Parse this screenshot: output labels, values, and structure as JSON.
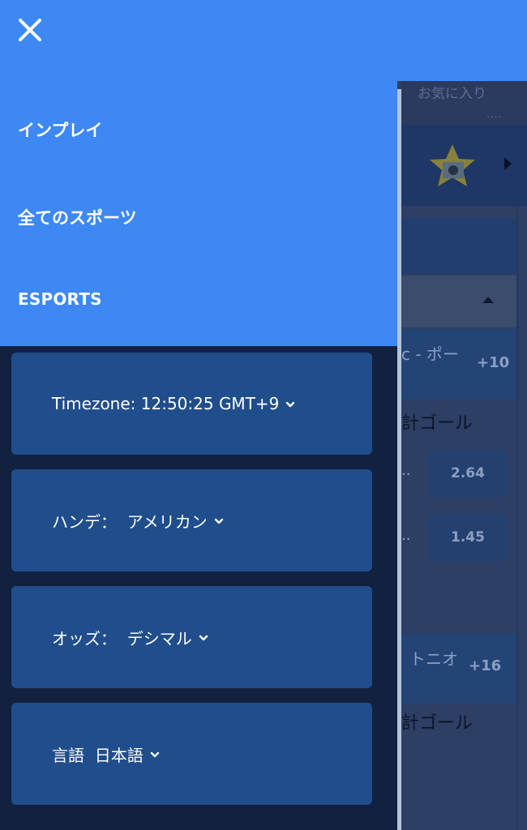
{
  "drawer": {
    "nav_items": [
      {
        "label": "インプレイ"
      },
      {
        "label": "全てのスポーツ"
      },
      {
        "label": "ESPORTS"
      }
    ],
    "settings": [
      {
        "label": "Timezone: 12:50:25 GMT+9"
      },
      {
        "label": "ハンデ：  アメリカン"
      },
      {
        "label": "オッズ：  デシマル"
      },
      {
        "label": "言語  日本語"
      }
    ]
  },
  "background": {
    "favorites_label": "お気に入り",
    "dots": "....",
    "match1": {
      "team": "c - ポー",
      "plus": "+10",
      "goal_label": "計ゴール"
    },
    "match2": {
      "team": "トニオ",
      "plus": "+16",
      "goal_label": "計ゴール"
    },
    "odds": [
      {
        "prefix": "..",
        "value": "2.64"
      },
      {
        "prefix": "..",
        "value": "1.45"
      }
    ]
  },
  "colors": {
    "header_blue": "#3d88f3",
    "drawer_dark": "#12213f",
    "setting_card": "#204e8c",
    "text_white": "#ffffff"
  },
  "icons": {
    "close": "close-icon",
    "chevron": "chevron-down-icon",
    "star": "star-icon"
  }
}
